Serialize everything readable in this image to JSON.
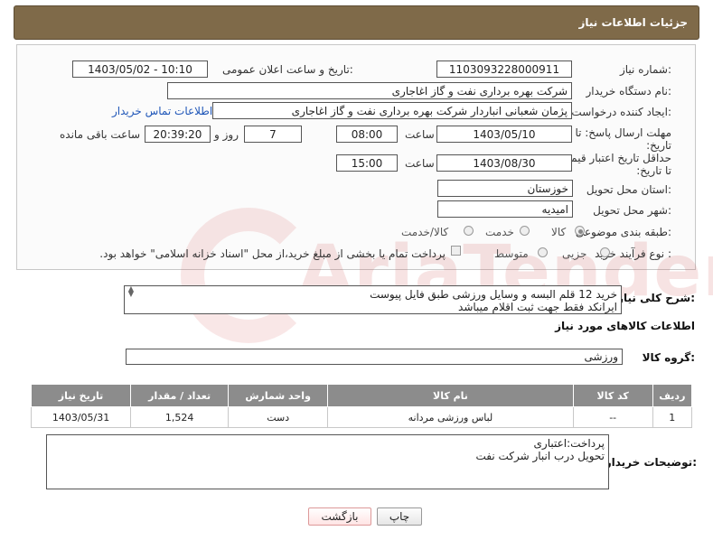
{
  "header": {
    "title": "جزئیات اطلاعات نیاز"
  },
  "form": {
    "need_number": {
      "label": "شماره نیاز:",
      "value": "1103093228000911"
    },
    "announce": {
      "label": "تاریخ و ساعت اعلان عمومی:",
      "value": "1403/05/02 - 10:10"
    },
    "buyer_org": {
      "label": "نام دستگاه خریدار:",
      "value": "شرکت بهره برداری نفت و گاز اغاجاری"
    },
    "requester": {
      "label": "ایجاد کننده درخواست:",
      "value": "پژمان شعبانی انباردار شرکت بهره برداری نفت و گاز اغاجاری",
      "contact_link": "اطلاعات تماس خریدار"
    },
    "deadline": {
      "label": "مهلت ارسال پاسخ: تا تاریخ:",
      "date": "1403/05/10",
      "time_label": "ساعت",
      "time": "08:00",
      "days": "7",
      "days_label": "روز و",
      "remaining": "20:39:20",
      "remaining_label": "ساعت باقی مانده"
    },
    "min_validity": {
      "label": "حداقل تاریخ اعتبار قیمت: تا تاریخ:",
      "date": "1403/08/30",
      "time_label": "ساعت",
      "time": "15:00"
    },
    "province": {
      "label": "استان محل تحویل:",
      "value": "خوزستان"
    },
    "city": {
      "label": "شهر محل تحویل:",
      "value": "امیدیه"
    },
    "category": {
      "label": "طبقه بندی موضوعی:",
      "options": [
        "کالا",
        "خدمت",
        "کالا/خدمت"
      ],
      "selected": "کالا"
    },
    "purchase_type": {
      "label": "نوع فرآیند خرید :",
      "options": [
        "جزیی",
        "متوسط"
      ],
      "selected": "جزیی",
      "checkbox_text": "پرداخت تمام یا بخشی از مبلغ خرید،از محل \"اسناد خزانه اسلامی\" خواهد بود."
    }
  },
  "watermark": {
    "text": "AriaTender.neT"
  },
  "description": {
    "label": "شرح کلی نیاز:",
    "lines": [
      "خرید 12 قلم البسه و وسایل ورزشی طبق فایل پیوست",
      "ایرانکد فقط جهت ثبت اقلام میباشد"
    ]
  },
  "goods_section": {
    "title": "اطلاعات کالاهای مورد نیاز"
  },
  "goods_group": {
    "label": "گروه کالا:",
    "value": "ورزشی"
  },
  "table": {
    "headers": [
      "ردیف",
      "کد کالا",
      "نام کالا",
      "واحد شمارش",
      "تعداد / مقدار",
      "تاریخ نیاز"
    ],
    "rows": [
      [
        "1",
        "--",
        "لباس ورزشی مردانه",
        "دست",
        "1,524",
        "1403/05/31"
      ]
    ]
  },
  "buyer_notes": {
    "label": "توضیحات خریدار:",
    "lines": [
      "پرداخت:اعتباری",
      "تحویل درب انبار شرکت نفت"
    ]
  },
  "buttons": {
    "print": "چاپ",
    "back": "بازگشت"
  }
}
